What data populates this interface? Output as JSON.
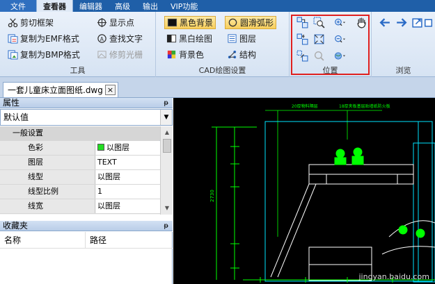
{
  "menu": {
    "file": "文件",
    "tabs": [
      "查看器",
      "编辑器",
      "高级",
      "输出",
      "VIP功能"
    ]
  },
  "ribbon": {
    "tools": {
      "label": "工具",
      "clip_frame": "剪切框架",
      "copy_emf": "复制为EMF格式",
      "copy_bmp": "复制为BMP格式",
      "show_points": "显示点",
      "find_text": "查找文字",
      "trim_raster": "修剪光栅"
    },
    "cad": {
      "label": "CAD绘图设置",
      "black_bg": "黑色背景",
      "smooth_arc": "圆滑弧形",
      "bw_drawing": "黑白绘图",
      "layers": "图层",
      "bg_color": "背景色",
      "structure": "结构"
    },
    "position": {
      "label": "位置"
    },
    "browse": {
      "label": "浏览"
    }
  },
  "document_tab": {
    "title": "一套儿童床立面图纸.dwg",
    "close": "×"
  },
  "properties": {
    "title": "属性",
    "pin": "ᵽ",
    "dropdown_value": "默认值",
    "group": "一般设置",
    "rows": [
      {
        "name": "色彩",
        "value": "以图层"
      },
      {
        "name": "图层",
        "value": "TEXT"
      },
      {
        "name": "线型",
        "value": "以图层"
      },
      {
        "name": "线型比例",
        "value": "1"
      },
      {
        "name": "线宽",
        "value": "以图层"
      }
    ]
  },
  "favorites": {
    "title": "收藏夹",
    "col_name": "名称",
    "col_path": "路径"
  },
  "drawing": {
    "annotation_left": "20厚物料隔层",
    "annotation_right": "18厚夹板基层贴墙纸防火板",
    "dim_vertical": "2730",
    "watermark": "jingyan.baidu.com"
  },
  "colors": {
    "menubar": "#1f5fa8",
    "highlight_box": "#e0201f",
    "drawing_bg": "#000000",
    "cad_green": "#00ff00",
    "cad_cyan": "#00e5ff"
  }
}
